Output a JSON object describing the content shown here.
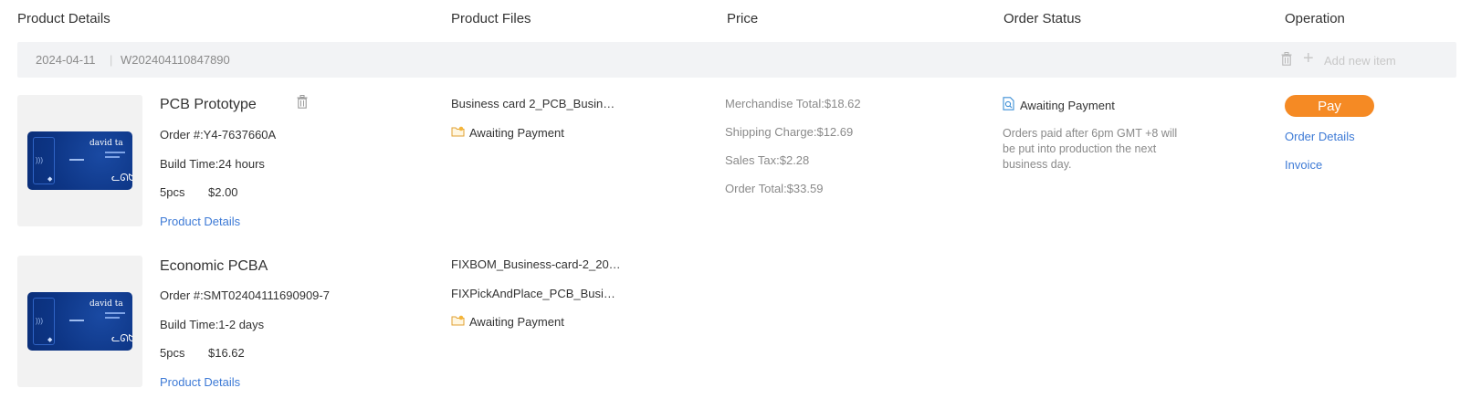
{
  "headers": {
    "product_details": "Product Details",
    "product_files": "Product Files",
    "price": "Price",
    "order_status": "Order Status",
    "operation": "Operation"
  },
  "order": {
    "date": "2024-04-11",
    "separator": "|",
    "number": "W202404110847890",
    "add_new_item": "Add new item",
    "icons": {
      "delete": "trash-icon",
      "add": "plus-icon"
    }
  },
  "thumbnail": {
    "brand_text": "david ta",
    "colors": {
      "card": "#0d3585",
      "card_light": "#1a4aa3"
    }
  },
  "items": [
    {
      "title": "PCB Prototype",
      "order_no": "Order #:Y4-7637660A",
      "build_time": "Build Time:24 hours",
      "qty": "5pcs",
      "price": "$2.00",
      "details_link": "Product Details",
      "files": [
        "Business card 2_PCB_Busin…"
      ],
      "file_status": "Awaiting Payment"
    },
    {
      "title": "Economic PCBA",
      "order_no": "Order #:SMT02404111690909-7",
      "build_time": "Build Time:1-2 days",
      "qty": "5pcs",
      "price": "$16.62",
      "details_link": "Product Details",
      "files": [
        "FIXBOM_Business-card-2_20…",
        "FIXPickAndPlace_PCB_Busi…"
      ],
      "file_status": "Awaiting Payment"
    }
  ],
  "price_summary": {
    "merchandise_total": "Merchandise Total:$18.62",
    "shipping_charge": "Shipping Charge:$12.69",
    "sales_tax": "Sales Tax:$2.28",
    "order_total": "Order Total:$33.59"
  },
  "order_status": {
    "label": "Awaiting Payment",
    "note": "Orders paid after 6pm GMT +8 will be put into production the next business day."
  },
  "operations": {
    "pay": "Pay",
    "order_details": "Order Details",
    "invoice": "Invoice"
  },
  "colors": {
    "accent_orange": "#f58a24",
    "link_blue": "#3d7ad6",
    "muted_gray": "#8a8a8a",
    "bar_bg": "#f2f3f5"
  }
}
